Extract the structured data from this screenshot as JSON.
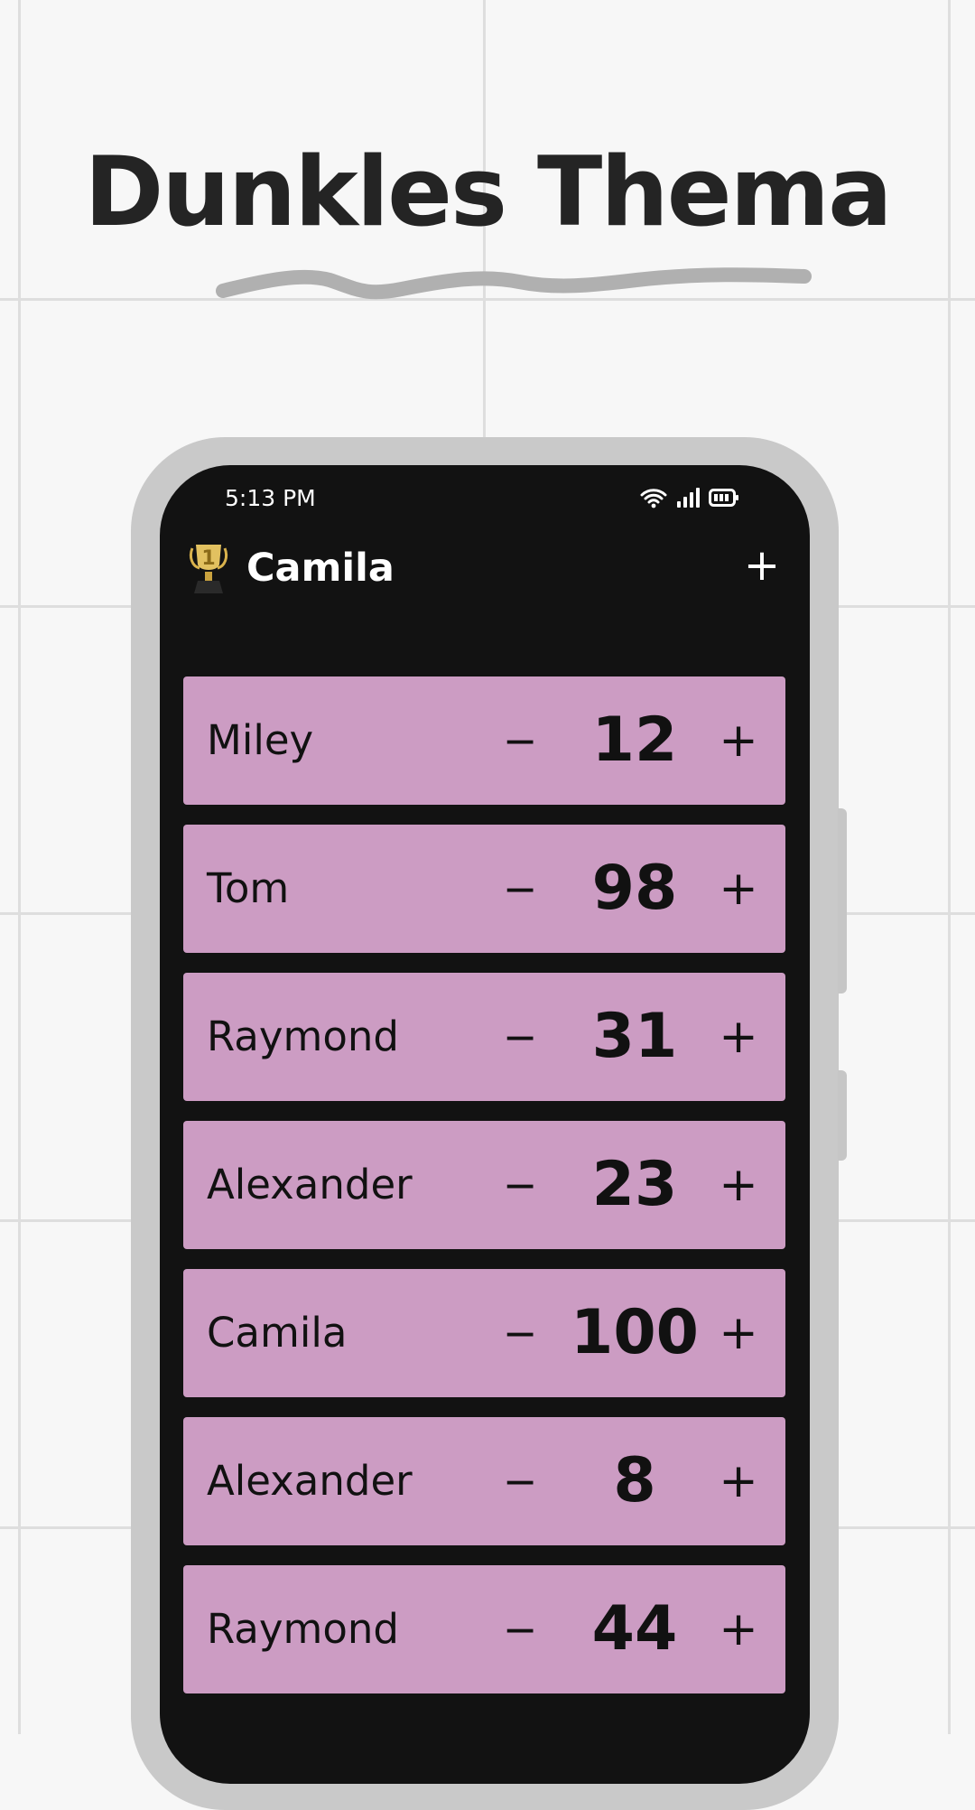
{
  "headline": "Dunkles Thema",
  "status_bar": {
    "time": "5:13 PM",
    "icons": [
      "wifi-icon",
      "cell-signal-icon",
      "battery-icon"
    ]
  },
  "app_bar": {
    "leader_icon": "trophy-icon",
    "leader_name": "Camila",
    "add_label": "+"
  },
  "controls": {
    "minus_label": "−",
    "plus_label": "+"
  },
  "players": [
    {
      "name": "Miley",
      "score": "12"
    },
    {
      "name": "Tom",
      "score": "98"
    },
    {
      "name": "Raymond",
      "score": "31"
    },
    {
      "name": "Alexander",
      "score": "23"
    },
    {
      "name": "Camila",
      "score": "100"
    },
    {
      "name": "Alexander",
      "score": "8"
    },
    {
      "name": "Raymond",
      "score": "44"
    }
  ],
  "colors": {
    "card": "#cc9cc3",
    "screen": "#121212",
    "page_background": "#f7f7f7"
  }
}
